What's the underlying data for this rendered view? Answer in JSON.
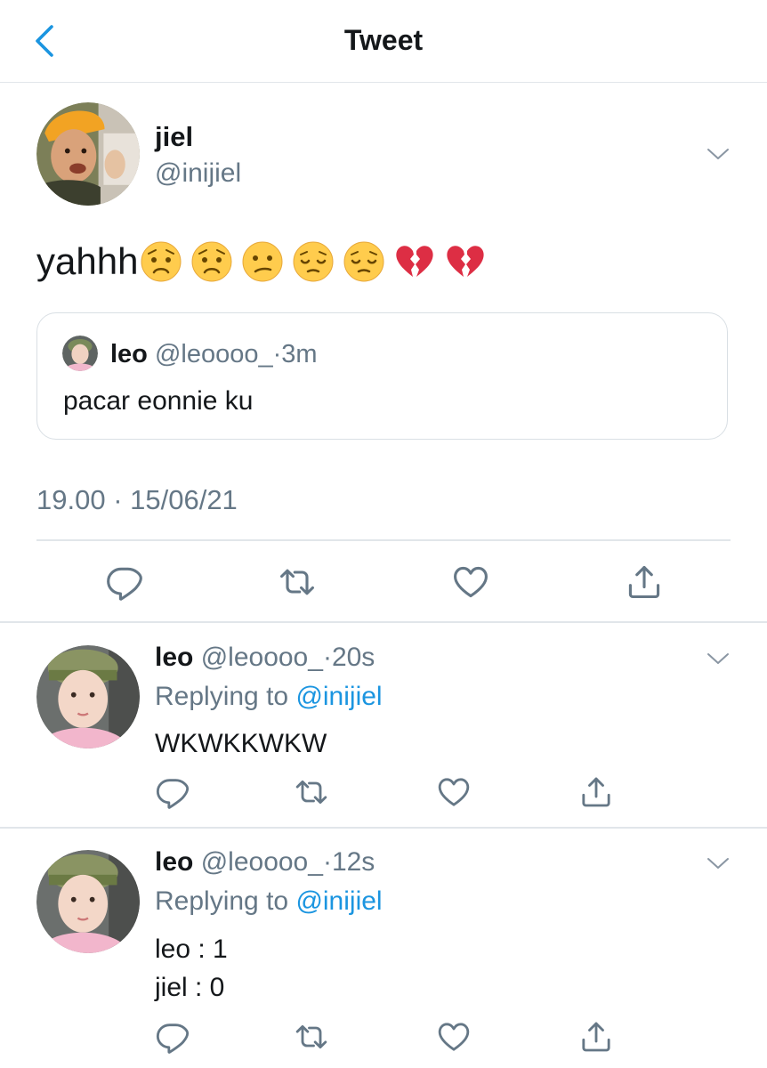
{
  "header": {
    "title": "Tweet",
    "back_icon": "chevron-left-icon"
  },
  "main_tweet": {
    "author_name": "jiel",
    "author_handle": "@inijiel",
    "text": "yahhh",
    "emojis": [
      "worried-face",
      "worried-face",
      "confused-face",
      "pensive-face",
      "pensive-face",
      "broken-heart",
      "broken-heart"
    ],
    "quoted": {
      "author_name": "leo",
      "author_handle": "@leoooo_",
      "separator": "·",
      "time": "3m",
      "text": "pacar eonnie ku"
    },
    "timestamp": "19.00 · 15/06/21",
    "actions": [
      "reply-icon",
      "retweet-icon",
      "like-icon",
      "share-icon"
    ]
  },
  "replies": [
    {
      "author_name": "leo",
      "author_handle": "@leoooo_",
      "separator": "·",
      "time": "20s",
      "replying_label": "Replying to ",
      "replying_to": "@inijiel",
      "lines": [
        "WKWKKWKW"
      ]
    },
    {
      "author_name": "leo",
      "author_handle": "@leoooo_",
      "separator": "·",
      "time": "12s",
      "replying_label": "Replying to ",
      "replying_to": "@inijiel",
      "lines": [
        "leo : 1",
        "jiel : 0"
      ]
    }
  ],
  "colors": {
    "accent": "#1b95e0",
    "secondary_text": "#657786",
    "icon": "#657786",
    "divider": "#e1e6ea"
  }
}
